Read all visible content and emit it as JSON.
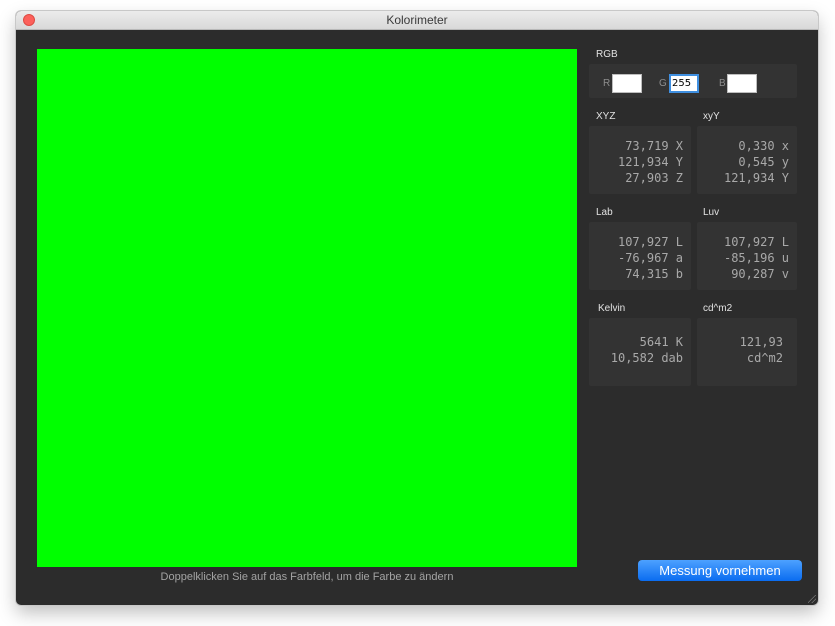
{
  "window": {
    "title": "Kolorimeter"
  },
  "swatch": {
    "color": "#00ff00",
    "hint": "Doppelklicken Sie auf das Farbfeld, um die Farbe zu ändern"
  },
  "rgb": {
    "heading": "RGB",
    "r_label": "R",
    "g_label": "G",
    "b_label": "B",
    "r_value": "",
    "g_value": "255",
    "b_value": ""
  },
  "xyz": {
    "heading": "XYZ",
    "rows": [
      "73,719 X",
      "121,934 Y",
      "27,903 Z"
    ]
  },
  "xyy": {
    "heading": "xyY",
    "rows": [
      "0,330 x",
      "0,545 y",
      "121,934 Y"
    ]
  },
  "lab": {
    "heading": "Lab",
    "rows": [
      "107,927 L",
      "-76,967 a",
      "74,315 b"
    ]
  },
  "luv": {
    "heading": "Luv",
    "rows": [
      "107,927 L",
      "-85,196 u",
      "90,287 v"
    ]
  },
  "kelvin": {
    "heading": "Kelvin",
    "rows": [
      "5641 K",
      "10,582 dab"
    ]
  },
  "luminance": {
    "heading": "cd^m2",
    "rows": [
      "121,93",
      "cd^m2"
    ]
  },
  "actions": {
    "measure_label": "Messung vornehmen"
  },
  "colors": {
    "accent": "#0a6cf0",
    "background": "#2c2c2c"
  }
}
